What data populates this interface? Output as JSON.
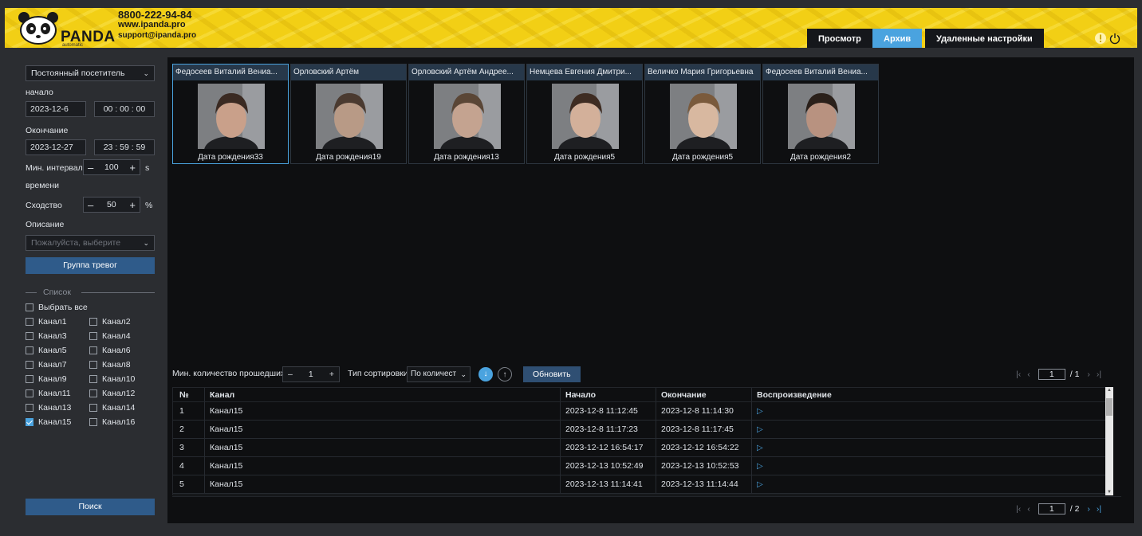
{
  "header": {
    "brand": "PANDA",
    "brand_sub": "automatic",
    "phone": "8800-222-94-84",
    "website": "www.ipanda.pro",
    "email": "support@ipanda.pro",
    "nav": [
      "Просмотр",
      "Архив",
      "Удаленные настройки"
    ],
    "active_nav": "Архив",
    "icons": [
      "info-icon",
      "power-icon"
    ]
  },
  "filter": {
    "visitor_type": "Постоянный посетитель",
    "start_label": "начало",
    "start_date": "2023-12-6",
    "start_time": "00 : 00 : 00",
    "end_label": "Окончание",
    "end_date": "2023-12-27",
    "end_time": "23 : 59 : 59",
    "min_interval_label": "Мин. интервал",
    "min_interval_label2": "времени",
    "min_interval_value": "100",
    "min_interval_unit": "s",
    "similarity_label": "Сходство",
    "similarity_value": "50",
    "similarity_unit": "%",
    "description_label": "Описание",
    "description_placeholder": "Пожалуйста, выберите",
    "alarm_group_button": "Группа тревог",
    "list_label": "Список",
    "select_all": "Выбрать все",
    "channels": [
      {
        "label": "Канал1",
        "checked": false
      },
      {
        "label": "Канал2",
        "checked": false
      },
      {
        "label": "Канал3",
        "checked": false
      },
      {
        "label": "Канал4",
        "checked": false
      },
      {
        "label": "Канал5",
        "checked": false
      },
      {
        "label": "Канал6",
        "checked": false
      },
      {
        "label": "Канал7",
        "checked": false
      },
      {
        "label": "Канал8",
        "checked": false
      },
      {
        "label": "Канал9",
        "checked": false
      },
      {
        "label": "Канал10",
        "checked": false
      },
      {
        "label": "Канал11",
        "checked": false
      },
      {
        "label": "Канал12",
        "checked": false
      },
      {
        "label": "Канал13",
        "checked": false
      },
      {
        "label": "Канал14",
        "checked": false
      },
      {
        "label": "Канал15",
        "checked": true
      },
      {
        "label": "Канал16",
        "checked": false
      }
    ],
    "search_button": "Поиск"
  },
  "faces": [
    {
      "name": "Федосеев Виталий Вениа...",
      "dob": "Дата рождения33",
      "selected": true
    },
    {
      "name": "Орловский Артём",
      "dob": "Дата рождения19",
      "selected": false
    },
    {
      "name": "Орловский Артём Андрее...",
      "dob": "Дата рождения13",
      "selected": false
    },
    {
      "name": "Немцева Евгения Дмитри...",
      "dob": "Дата рождения5",
      "selected": false
    },
    {
      "name": "Величко Мария Григорьевна",
      "dob": "Дата рождения5",
      "selected": false
    },
    {
      "name": "Федосеев Виталий Вениа...",
      "dob": "Дата рождения2",
      "selected": false
    }
  ],
  "toolbar": {
    "min_count_label": "Мин. количество прошедших",
    "min_count_value": "1",
    "sort_label": "Тип сортировки",
    "sort_value": "По количест",
    "refresh_button": "Обновить"
  },
  "top_pager": {
    "current": "1",
    "total": "/ 1"
  },
  "table": {
    "columns": [
      "№",
      "Канал",
      "Начало",
      "Окончание",
      "Воспроизведение"
    ],
    "rows": [
      {
        "n": "1",
        "channel": "Канал15",
        "start": "2023-12-8 11:12:45",
        "end": "2023-12-8 11:14:30"
      },
      {
        "n": "2",
        "channel": "Канал15",
        "start": "2023-12-8 11:17:23",
        "end": "2023-12-8 11:17:45"
      },
      {
        "n": "3",
        "channel": "Канал15",
        "start": "2023-12-12 16:54:17",
        "end": "2023-12-12 16:54:22"
      },
      {
        "n": "4",
        "channel": "Канал15",
        "start": "2023-12-13 10:52:49",
        "end": "2023-12-13 10:52:53"
      },
      {
        "n": "5",
        "channel": "Канал15",
        "start": "2023-12-13 11:14:41",
        "end": "2023-12-13 11:14:44"
      }
    ]
  },
  "bottom_pager": {
    "current": "1",
    "total": "/ 2"
  },
  "colors": {
    "accent": "#4aa3df",
    "header_bg": "#f2cf15",
    "button_blue": "#2f5b8a"
  }
}
